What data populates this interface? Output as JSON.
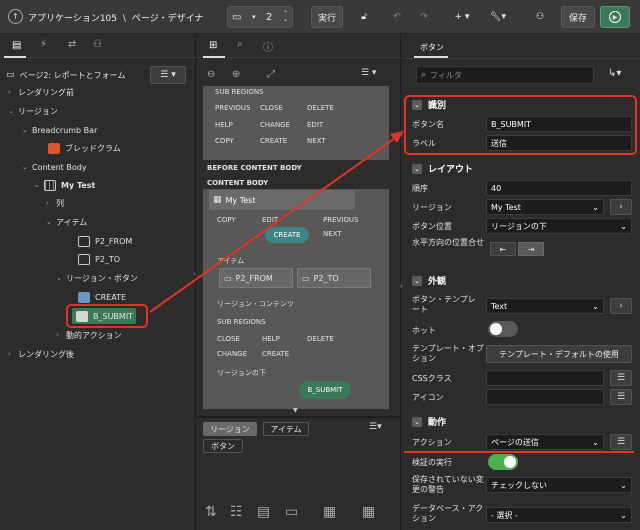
{
  "topbar": {
    "app_title": "アプリケーション105",
    "separator": "\\",
    "page_designer": "ページ・デザイナ",
    "page_number": "2",
    "run_label": "実行",
    "save_label": "保存"
  },
  "left": {
    "page_header": "ページ2: レポートとフォーム",
    "items": [
      {
        "label": "レンダリング前"
      },
      {
        "label": "リージョン"
      },
      {
        "label": "Breadcrumb Bar"
      },
      {
        "label": "ブレッドクラム"
      },
      {
        "label": "Content Body"
      },
      {
        "label": "My Test"
      },
      {
        "label": "列"
      },
      {
        "label": "アイテム"
      },
      {
        "label": "P2_FROM"
      },
      {
        "label": "P2_TO"
      },
      {
        "label": "リージョン・ボタン"
      },
      {
        "label": "CREATE"
      },
      {
        "label": "B_SUBMIT"
      },
      {
        "label": "動的アクション"
      },
      {
        "label": "レンダリング後"
      }
    ]
  },
  "mid": {
    "sub_regions": "SUB REGIONS",
    "btn_row1": [
      "PREVIOUS",
      "CLOSE",
      "DELETE"
    ],
    "btn_row2": [
      "HELP",
      "CHANGE",
      "EDIT"
    ],
    "btn_row3": [
      "COPY",
      "CREATE",
      "NEXT"
    ],
    "before_content_body": "BEFORE CONTENT BODY",
    "content_body": "CONTENT BODY",
    "region_title": "My Test",
    "reg_copy": "COPY",
    "reg_edit": "EDIT",
    "reg_previous": "PREVIOUS",
    "reg_next": "NEXT",
    "reg_create": "CREATE",
    "items_label": "アイテム",
    "item1": "P2_FROM",
    "item2": "P2_TO",
    "region_contents": "リージョン・コンテンツ",
    "sub_regions2": "SUB REGIONS",
    "sub_btns": [
      "CLOSE",
      "HELP",
      "DELETE"
    ],
    "sub_btns2": [
      "CHANGE",
      "CREATE"
    ],
    "region_below": "リージョンの下",
    "b_submit": "B_SUBMIT",
    "tab_region": "リージョン",
    "tab_item": "アイテム",
    "tab_button": "ボタン"
  },
  "right": {
    "tab": "ボタン",
    "filter_placeholder": "フィルタ",
    "sec_identify": "識別",
    "button_name_label": "ボタン名",
    "button_name": "B_SUBMIT",
    "label_label": "ラベル",
    "label_value": "送信",
    "sec_layout": "レイアウト",
    "seq_label": "順序",
    "seq_value": "40",
    "region_label": "リージョン",
    "region_value": "My Test",
    "position_label": "ボタン位置",
    "position_value": "リージョンの下",
    "halign_label": "水平方向の位置合せ",
    "sec_appearance": "外観",
    "template_label": "ボタン・テンプレート",
    "template_value": "Text",
    "hot_label": "ホット",
    "template_opt_label": "テンプレート・オプション",
    "template_opt_button": "テンプレート・デフォルトの使用",
    "css_label": "CSSクラス",
    "icon_label": "アイコン",
    "sec_action": "動作",
    "action_label": "アクション",
    "action_value": "ページの送信",
    "validate_label": "検証の実行",
    "unsaved_label": "保存されていない変更の警告",
    "unsaved_value": "チェックしない",
    "db_action_label": "データベース・アクション",
    "db_action_value": "- 選択 -"
  },
  "colors": {
    "accent_green": "#3b7a57",
    "highlight_red": "#e0362a",
    "toggle_on": "#4caf50"
  }
}
